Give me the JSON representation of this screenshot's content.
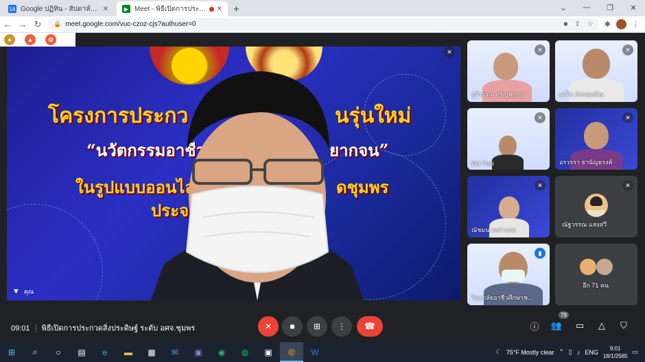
{
  "browser": {
    "tabs": [
      {
        "title": "Google ปฏิทิน - สัปดาห์ของวันที่ 16 ม",
        "active": false,
        "favicon": "calendar-icon"
      },
      {
        "title": "Meet - พิธีเปิดการประกวดสิ่งประ",
        "active": true,
        "favicon": "meet-icon",
        "recording": true
      }
    ],
    "new_tab": "+",
    "url": "meet.google.com/vuc-czoz-cjs?authuser=0",
    "window_controls": [
      "⌄",
      "—",
      "❐",
      "✕"
    ]
  },
  "main_video": {
    "banner_lines": [
      "โครงการประกว",
      "นรุ่นใหม่",
      "“นวัตกรรมอาชีวะ",
      "ยากจน”",
      "ในรูปแบบออนไล",
      "ดชุมพร",
      "ประจ"
    ],
    "name_label": "คุณ"
  },
  "participants": [
    {
      "name": "จุรีวรรณ อรัญพฤกษ์",
      "muted": true,
      "type": "slide"
    },
    {
      "name": "เดโช ภัทรพลคิณ",
      "muted": true,
      "type": "slide"
    },
    {
      "name": "Wit Thai",
      "muted": true,
      "type": "slide"
    },
    {
      "name": "อรวรรา ธานัญธรงค์",
      "muted": true,
      "type": "slide-blue"
    },
    {
      "name": "ณัชมน เหล่าเมฆ",
      "muted": true,
      "type": "slide-blue"
    },
    {
      "name": "ณัฐวรรณ แสงสวี",
      "muted": true,
      "type": "avatar"
    },
    {
      "name": "วิทยาลัยอาชีวศึกษาช...",
      "muted": false,
      "type": "slide",
      "speaking": true
    },
    {
      "name": "อีก 71 คน",
      "muted": false,
      "type": "more"
    }
  ],
  "meeting": {
    "time": "09:01",
    "title": "พิธีเปิดการประกวดสิ่งประดิษฐ์ ระดับ อศจ.ชุมพร",
    "participant_count": "79"
  },
  "taskbar": {
    "weather": "75°F  Mostly clear",
    "language": "ENG",
    "time": "9:01",
    "date": "18/1/2565"
  },
  "colors": {
    "meet_bg": "#202124",
    "red": "#ea4335",
    "banner_yellow": "#ffd21a"
  }
}
